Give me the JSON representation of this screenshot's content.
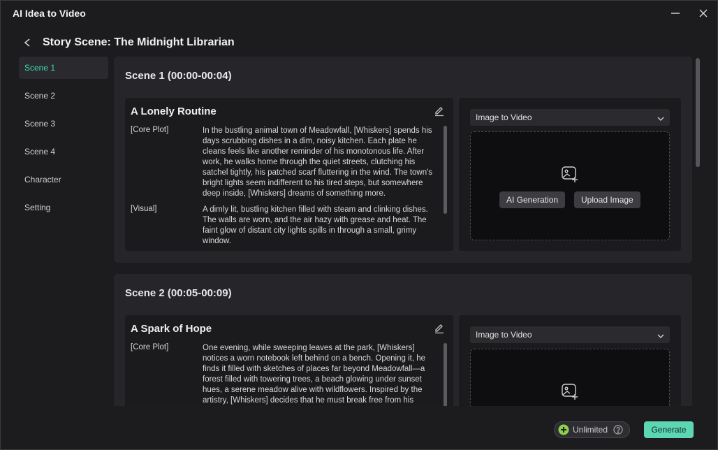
{
  "window": {
    "title": "AI Idea to Video"
  },
  "header": {
    "title": "Story Scene: The Midnight Librarian"
  },
  "sidebar": {
    "items": [
      {
        "label": "Scene 1",
        "active": true
      },
      {
        "label": "Scene 2",
        "active": false
      },
      {
        "label": "Scene 3",
        "active": false
      },
      {
        "label": "Scene 4",
        "active": false
      },
      {
        "label": "Character",
        "active": false
      },
      {
        "label": "Setting",
        "active": false
      }
    ]
  },
  "scenes": [
    {
      "heading": "Scene 1 (00:00-00:04)",
      "story_title": "A Lonely Routine",
      "core_plot_label": "[Core Plot]",
      "core_plot": "In the bustling animal town of Meadowfall, [Whiskers] spends his days scrubbing dishes in a dim, noisy kitchen. Each plate he cleans feels like another reminder of his monotonous life. After work, he walks home through the quiet streets, clutching his satchel tightly, his patched scarf fluttering in the wind. The town's bright lights seem indifferent to his tired steps, but somewhere deep inside, [Whiskers] dreams of something more.",
      "visual_label": "[Visual]",
      "visual": "A dimly lit, bustling kitchen filled with steam and clinking dishes. The walls are worn, and the air hazy with grease and heat. The faint glow of distant city lights spills in through a small, grimy window.",
      "mode": "Image to Video",
      "ai_generation_label": "AI Generation",
      "upload_image_label": "Upload Image"
    },
    {
      "heading": "Scene 2 (00:05-00:09)",
      "story_title": "A Spark of Hope",
      "core_plot_label": "[Core Plot]",
      "core_plot": "One evening, while sweeping leaves at the park, [Whiskers] notices a worn notebook left behind on a bench. Opening it, he finds it filled with sketches of places far beyond Meadowfall—a forest filled with towering trees, a beach glowing under sunset hues, a serene meadow alive with wildflowers. Inspired by the artistry, [Whiskers] decides that he must break free from his",
      "mode": "Image to Video"
    }
  ],
  "footer": {
    "unlimited_label": "Unlimited",
    "generate_label": "Generate",
    "accent_color": "#5cd6b3"
  }
}
